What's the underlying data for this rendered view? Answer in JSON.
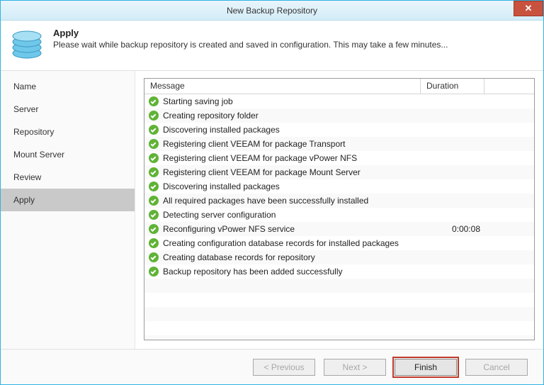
{
  "window": {
    "title": "New Backup Repository"
  },
  "header": {
    "title": "Apply",
    "subtitle": "Please wait while backup repository is created and saved in configuration. This may take a few minutes..."
  },
  "sidebar": {
    "items": [
      {
        "label": "Name"
      },
      {
        "label": "Server"
      },
      {
        "label": "Repository"
      },
      {
        "label": "Mount Server"
      },
      {
        "label": "Review"
      },
      {
        "label": "Apply",
        "active": true
      }
    ]
  },
  "grid": {
    "columns": {
      "message": "Message",
      "duration": "Duration"
    },
    "rows": [
      {
        "status": "ok",
        "message": "Starting saving job",
        "duration": ""
      },
      {
        "status": "ok",
        "message": "Creating repository folder",
        "duration": ""
      },
      {
        "status": "ok",
        "message": "Discovering installed packages",
        "duration": ""
      },
      {
        "status": "ok",
        "message": "Registering client VEEAM for package Transport",
        "duration": ""
      },
      {
        "status": "ok",
        "message": "Registering client VEEAM for package vPower NFS",
        "duration": ""
      },
      {
        "status": "ok",
        "message": "Registering client VEEAM for package Mount Server",
        "duration": ""
      },
      {
        "status": "ok",
        "message": "Discovering installed packages",
        "duration": ""
      },
      {
        "status": "ok",
        "message": "All required packages have been successfully installed",
        "duration": ""
      },
      {
        "status": "ok",
        "message": "Detecting server configuration",
        "duration": ""
      },
      {
        "status": "ok",
        "message": "Reconfiguring vPower NFS service",
        "duration": "0:00:08"
      },
      {
        "status": "ok",
        "message": "Creating configuration database records for installed packages",
        "duration": ""
      },
      {
        "status": "ok",
        "message": "Creating database records for repository",
        "duration": ""
      },
      {
        "status": "ok",
        "message": "Backup repository has been added successfully",
        "duration": ""
      }
    ],
    "blank_rows": 5
  },
  "footer": {
    "previous": "< Previous",
    "next": "Next >",
    "finish": "Finish",
    "cancel": "Cancel"
  }
}
